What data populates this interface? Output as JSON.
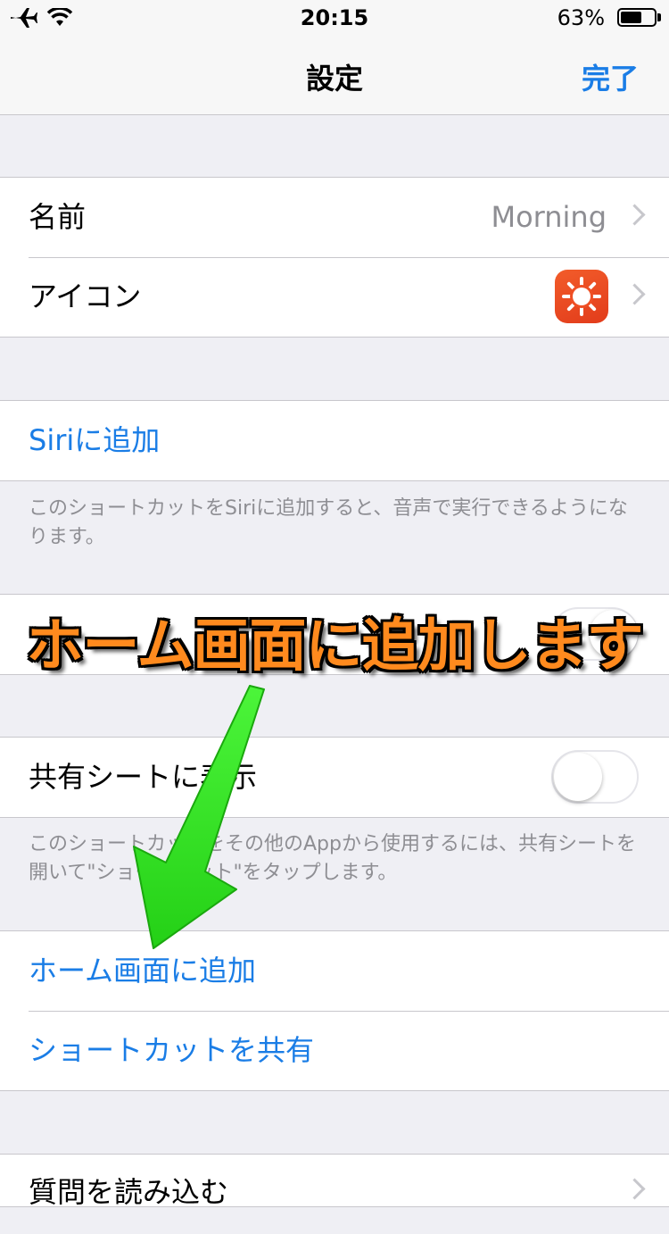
{
  "status_bar": {
    "time": "20:15",
    "battery_percent_text": "63%",
    "battery_level": 0.63
  },
  "nav": {
    "title": "設定",
    "done": "完了"
  },
  "group1": {
    "name_label": "名前",
    "name_value": "Morning",
    "icon_label": "アイコン",
    "icon_name": "sun-icon",
    "icon_color": "#ef4f24"
  },
  "siri": {
    "add_label": "Siriに追加",
    "footer": "このショートカットをSiriに追加すると、音声で実行できるようになります。"
  },
  "widget_row": {
    "toggle_on": true
  },
  "share": {
    "share_sheet_label": "共有シートに表示",
    "toggle_on": false,
    "footer": "このショートカットをその他のAppから使用するには、共有シートを開いて\"ショートカット\"をタップします。"
  },
  "actions": {
    "add_home": "ホーム画面に追加",
    "share_shortcut": "ショートカットを共有"
  },
  "import": {
    "label": "質問を読み込む"
  },
  "annotation": {
    "text": "ホーム画面に追加します",
    "arrow_color": "#2fe01d",
    "text_color": "#ff8a1e"
  },
  "colors": {
    "accent": "#1a7de6",
    "background": "#efeff4"
  }
}
